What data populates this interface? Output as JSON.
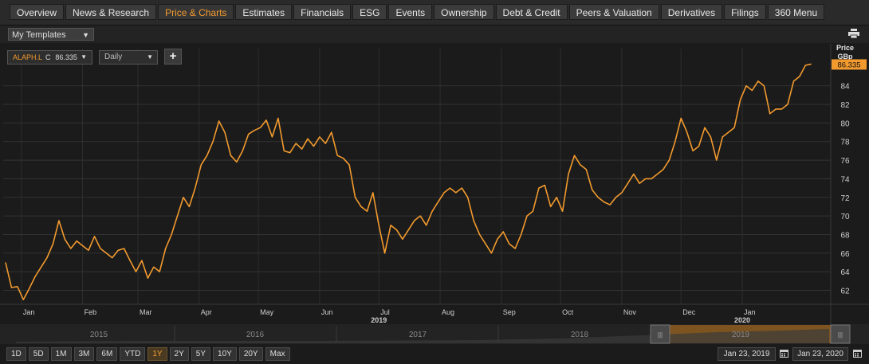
{
  "nav": {
    "tabs": [
      "Overview",
      "News & Research",
      "Price & Charts",
      "Estimates",
      "Financials",
      "ESG",
      "Events",
      "Ownership",
      "Debt & Credit",
      "Peers & Valuation",
      "Derivatives",
      "Filings",
      "360 Menu"
    ],
    "active_index": 2
  },
  "templates": {
    "label": "My Templates"
  },
  "instrument": {
    "symbol": "ALAPH.L",
    "field": "C",
    "value": "86.335",
    "interval": "Daily"
  },
  "axis": {
    "title_line1": "Price",
    "title_line2": "GBp",
    "current_label": "86.335"
  },
  "navigator": {
    "years": [
      "2015",
      "2016",
      "2017",
      "2018",
      "2019"
    ]
  },
  "period_buttons": [
    "1D",
    "5D",
    "1M",
    "3M",
    "6M",
    "YTD",
    "1Y",
    "2Y",
    "5Y",
    "10Y",
    "20Y",
    "Max"
  ],
  "period_active": "1Y",
  "date_range": {
    "start": "Jan 23, 2019",
    "end": "Jan 23, 2020"
  },
  "colors": {
    "series": "#f29a2e",
    "accent": "#f29a2e"
  },
  "chart_data": {
    "type": "line",
    "series": [
      {
        "name": "ALAPH.L",
        "points": [
          [
            1,
            65
          ],
          [
            4,
            62.3
          ],
          [
            7,
            62.4
          ],
          [
            10,
            61
          ],
          [
            13,
            62.2
          ],
          [
            16,
            63.5
          ],
          [
            19,
            64.5
          ],
          [
            22,
            65.5
          ],
          [
            25,
            67
          ],
          [
            28,
            69.5
          ],
          [
            31,
            67.5
          ],
          [
            34,
            66.5
          ],
          [
            37,
            67.3
          ],
          [
            40,
            66.8
          ],
          [
            43,
            66.3
          ],
          [
            46,
            67.8
          ],
          [
            49,
            66.5
          ],
          [
            52,
            66
          ],
          [
            55,
            65.5
          ],
          [
            58,
            66.3
          ],
          [
            61,
            66.5
          ],
          [
            64,
            65.2
          ],
          [
            67,
            64
          ],
          [
            70,
            65.2
          ],
          [
            73,
            63.3
          ],
          [
            76,
            64.5
          ],
          [
            79,
            64
          ],
          [
            82,
            66.5
          ],
          [
            85,
            68
          ],
          [
            88,
            70
          ],
          [
            91,
            72
          ],
          [
            94,
            71
          ],
          [
            97,
            73
          ],
          [
            100,
            75.5
          ],
          [
            103,
            76.5
          ],
          [
            106,
            78
          ],
          [
            109,
            80.2
          ],
          [
            112,
            79
          ],
          [
            115,
            76.5
          ],
          [
            118,
            75.8
          ],
          [
            121,
            77
          ],
          [
            124,
            78.8
          ],
          [
            127,
            79.2
          ],
          [
            130,
            79.5
          ],
          [
            133,
            80.3
          ],
          [
            136,
            78.5
          ],
          [
            139,
            80.5
          ],
          [
            142,
            77
          ],
          [
            145,
            76.8
          ],
          [
            148,
            77.8
          ],
          [
            151,
            77.2
          ],
          [
            154,
            78.3
          ],
          [
            157,
            77.5
          ],
          [
            160,
            78.5
          ],
          [
            163,
            77.8
          ],
          [
            166,
            79
          ],
          [
            169,
            76.5
          ],
          [
            172,
            76.2
          ],
          [
            175,
            75.5
          ],
          [
            178,
            72
          ],
          [
            181,
            71
          ],
          [
            184,
            70.5
          ],
          [
            187,
            72.5
          ],
          [
            190,
            69
          ],
          [
            193,
            66
          ],
          [
            196,
            69
          ],
          [
            199,
            68.5
          ],
          [
            202,
            67.5
          ],
          [
            205,
            68.5
          ],
          [
            208,
            69.5
          ],
          [
            211,
            70
          ],
          [
            214,
            69
          ],
          [
            217,
            70.5
          ],
          [
            220,
            71.5
          ],
          [
            223,
            72.5
          ],
          [
            226,
            73
          ],
          [
            229,
            72.5
          ],
          [
            232,
            73
          ],
          [
            235,
            72
          ],
          [
            238,
            69.5
          ],
          [
            241,
            68
          ],
          [
            244,
            67
          ],
          [
            247,
            66
          ],
          [
            250,
            67.5
          ],
          [
            253,
            68.3
          ],
          [
            256,
            67
          ],
          [
            259,
            66.5
          ],
          [
            262,
            68
          ],
          [
            265,
            70
          ],
          [
            268,
            70.5
          ],
          [
            271,
            73
          ],
          [
            274,
            73.3
          ],
          [
            277,
            71
          ],
          [
            280,
            72
          ],
          [
            283,
            70.5
          ],
          [
            286,
            74.5
          ],
          [
            289,
            76.5
          ],
          [
            292,
            75.5
          ],
          [
            295,
            75
          ],
          [
            298,
            72.8
          ],
          [
            301,
            72
          ],
          [
            304,
            71.5
          ],
          [
            307,
            71.2
          ],
          [
            310,
            72
          ],
          [
            313,
            72.5
          ],
          [
            316,
            73.5
          ],
          [
            319,
            74.5
          ],
          [
            322,
            73.5
          ],
          [
            325,
            74
          ],
          [
            328,
            74
          ],
          [
            331,
            74.5
          ],
          [
            334,
            75
          ],
          [
            337,
            76
          ],
          [
            340,
            78
          ],
          [
            343,
            80.5
          ],
          [
            346,
            79
          ],
          [
            349,
            77
          ],
          [
            352,
            77.5
          ],
          [
            355,
            79.5
          ],
          [
            358,
            78.5
          ],
          [
            361,
            76
          ],
          [
            364,
            78.5
          ],
          [
            367,
            79
          ],
          [
            370,
            79.5
          ],
          [
            373,
            82.5
          ],
          [
            376,
            84
          ],
          [
            379,
            83.5
          ],
          [
            382,
            84.5
          ],
          [
            385,
            84
          ],
          [
            388,
            81
          ],
          [
            391,
            81.5
          ],
          [
            394,
            81.5
          ],
          [
            397,
            82
          ],
          [
            400,
            84.5
          ],
          [
            403,
            85
          ],
          [
            406,
            86.2
          ],
          [
            409,
            86.335
          ]
        ],
        "x_unit": "days since Jan 23, 2019"
      }
    ],
    "x_tick_labels": [
      "Jan",
      "Feb",
      "Mar",
      "Apr",
      "May",
      "Jun",
      "Jul",
      "Aug",
      "Sep",
      "Oct",
      "Nov",
      "Dec",
      "Jan"
    ],
    "x_year_labels": [
      "2019",
      "2020"
    ],
    "y_ticks": [
      62,
      64,
      66,
      68,
      70,
      72,
      74,
      76,
      78,
      80,
      82,
      84
    ],
    "ylim": [
      60.5,
      88
    ],
    "ylabel": "Price GBp",
    "grid": true
  }
}
